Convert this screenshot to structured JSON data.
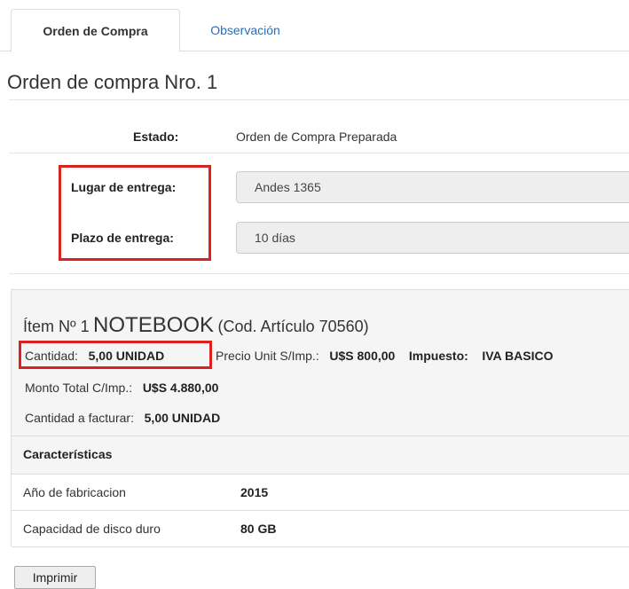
{
  "tabs": [
    {
      "label": "Orden de Compra",
      "active": true
    },
    {
      "label": "Observación",
      "active": false
    }
  ],
  "page_title": "Orden de compra Nro. 1",
  "estado": {
    "label": "Estado:",
    "value": "Orden de Compra Preparada"
  },
  "lugar_entrega": {
    "label": "Lugar de entrega:",
    "value": "Andes 1365"
  },
  "plazo_entrega": {
    "label": "Plazo de entrega:",
    "value": "10 días"
  },
  "item": {
    "prefix": "Ítem Nº 1",
    "name": "NOTEBOOK",
    "code": "(Cod. Artículo 70560)",
    "cantidad_label": "Cantidad:",
    "cantidad_value": "5,00 UNIDAD",
    "precio_label": "Precio Unit S/Imp.:",
    "precio_value": "U$S 800,00",
    "impuesto_label": "Impuesto:",
    "impuesto_value": "IVA BASICO",
    "monto_label": "Monto Total C/Imp.:",
    "monto_value": "U$S 4.880,00",
    "facturar_label": "Cantidad a facturar:",
    "facturar_value": "5,00 UNIDAD"
  },
  "caracteristicas": {
    "header": "Características",
    "rows": [
      {
        "label": "Año de fabricacion",
        "value": "2015"
      },
      {
        "label": "Capacidad de disco duro",
        "value": "80 GB"
      }
    ]
  },
  "print_button": "Imprimir",
  "colors": {
    "highlight": "#d9231e",
    "link": "#2a6fb3"
  }
}
